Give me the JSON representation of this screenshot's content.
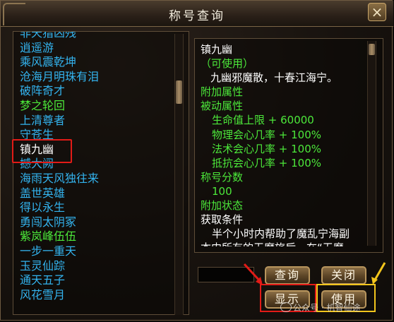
{
  "window": {
    "title": "称号查询",
    "close_glyph": "×"
  },
  "title_list": {
    "items": [
      {
        "label": "非天猎凶残",
        "color": "blue"
      },
      {
        "label": "逍遥游",
        "color": "blue"
      },
      {
        "label": "乘风震乾坤",
        "color": "blue"
      },
      {
        "label": "沧海月明珠有泪",
        "color": "blue"
      },
      {
        "label": "破阵奇才",
        "color": "blue"
      },
      {
        "label": "梦之轮回",
        "color": "green"
      },
      {
        "label": "上清尊者",
        "color": "blue"
      },
      {
        "label": "守苍生",
        "color": "blue"
      },
      {
        "label": "镇九幽",
        "color": "white",
        "selected": true
      },
      {
        "label": "撼大阙",
        "color": "blue"
      },
      {
        "label": "海雨天风独往来",
        "color": "blue"
      },
      {
        "label": "盖世英雄",
        "color": "blue"
      },
      {
        "label": "得以永生",
        "color": "blue"
      },
      {
        "label": "勇闯太阴冢",
        "color": "blue"
      },
      {
        "label": "紫岚峰伍伍",
        "color": "green"
      },
      {
        "label": "一步一重天",
        "color": "blue"
      },
      {
        "label": "玉灵仙踪",
        "color": "blue"
      },
      {
        "label": "通天五子",
        "color": "blue"
      },
      {
        "label": "风花雪月",
        "color": "blue"
      }
    ],
    "scroll_position": 0.2
  },
  "detail": {
    "name": "镇九幽",
    "status": "（可使用）",
    "description": "九幽邪魔散，十春江海宁。",
    "extra_attr_header": "附加属性",
    "passive_attr_header": "被动属性",
    "attributes": [
      "生命值上限 + 60000",
      "物理会心几率 + 100%",
      "法术会心几率 + 100%",
      "抵抗会心几率 + 100%"
    ],
    "score_header": "称号分数",
    "score": "100",
    "extra_state_header": "附加状态",
    "condition_header": "获取条件",
    "condition_line1": "半个小时内帮助了魔乱宁海副",
    "condition_line2": "本内所有的无魔旅后，在“无魔",
    "scroll_position": 0.0
  },
  "buttons": {
    "query": "查询",
    "close": "关闭",
    "show": "显示",
    "use": "使用"
  },
  "watermark": "公众号 · 机智仙途",
  "colors": {
    "list_blue": "#33b3ee",
    "list_green": "#4ce83a",
    "highlight_red": "#e21b17",
    "highlight_gold": "#f2c51c"
  }
}
